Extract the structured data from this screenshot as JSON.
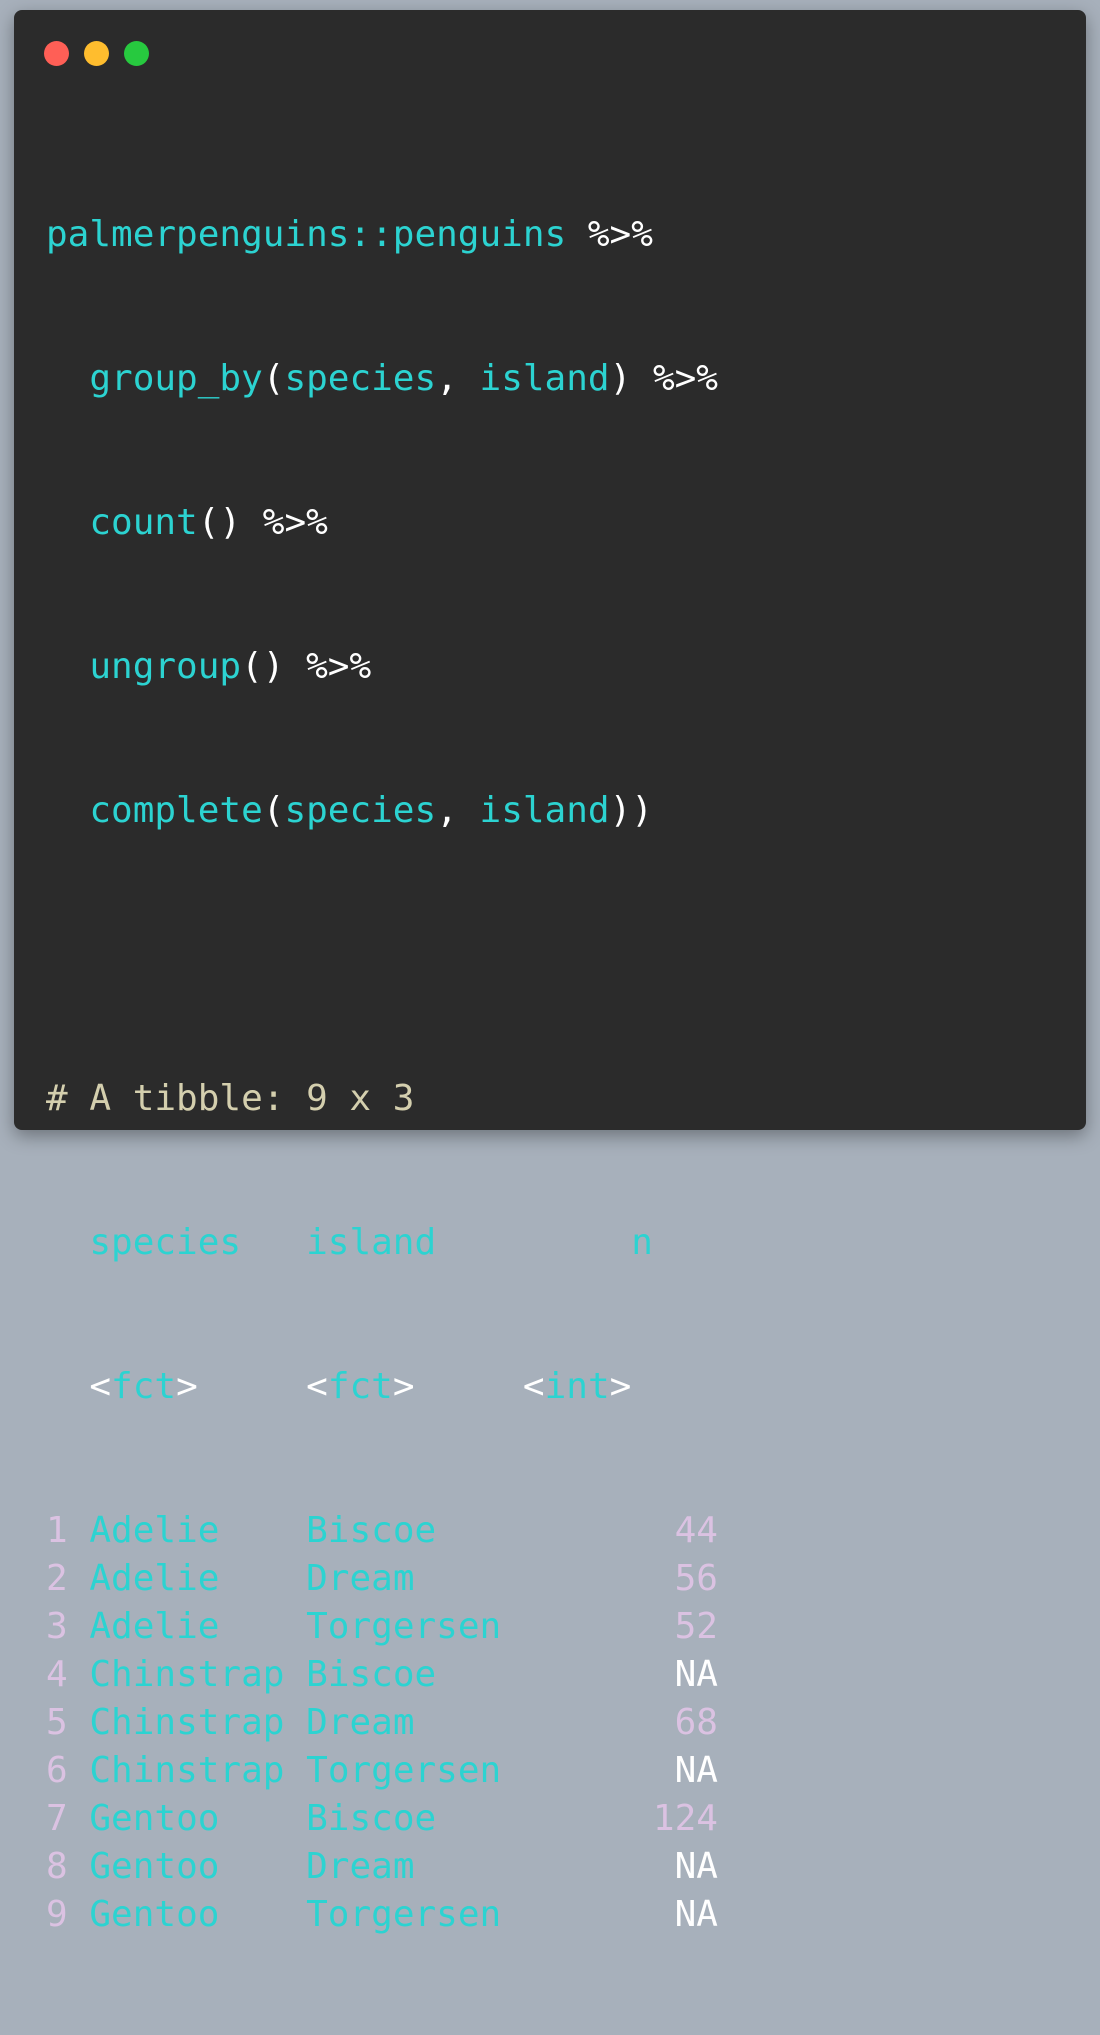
{
  "window": {
    "controls": [
      "close",
      "minimize",
      "maximize"
    ],
    "colors": {
      "close": "#ff5f56",
      "minimize": "#ffbd2e",
      "maximize": "#27c93f"
    }
  },
  "code": {
    "line1": {
      "fn": "palmerpenguins::penguins",
      "pipe": "%>%"
    },
    "line2": {
      "fn": "group_by",
      "open": "(",
      "arg1": "species",
      "comma": ",",
      "arg2": "island",
      "close": ")",
      "pipe": "%>%"
    },
    "line3": {
      "fn": "count",
      "parens": "()",
      "pipe": "%>%"
    },
    "line4": {
      "fn": "ungroup",
      "parens": "()",
      "pipe": "%>%"
    },
    "line5": {
      "fn": "complete",
      "open": "(",
      "arg1": "species",
      "comma": ",",
      "arg2": "island",
      "close": "))"
    }
  },
  "output": {
    "header": "# A tibble: 9 x 3",
    "columns": [
      "species",
      "island",
      "n"
    ],
    "types": [
      {
        "lt": "<",
        "name": "fct",
        "gt": ">"
      },
      {
        "lt": "<",
        "name": "fct",
        "gt": ">"
      },
      {
        "lt": "<",
        "name": "int",
        "gt": ">"
      }
    ],
    "rows": [
      {
        "idx": "1",
        "species": "Adelie",
        "island": "Biscoe",
        "n": "44"
      },
      {
        "idx": "2",
        "species": "Adelie",
        "island": "Dream",
        "n": "56"
      },
      {
        "idx": "3",
        "species": "Adelie",
        "island": "Torgersen",
        "n": "52"
      },
      {
        "idx": "4",
        "species": "Chinstrap",
        "island": "Biscoe",
        "n": "NA"
      },
      {
        "idx": "5",
        "species": "Chinstrap",
        "island": "Dream",
        "n": "68"
      },
      {
        "idx": "6",
        "species": "Chinstrap",
        "island": "Torgersen",
        "n": "NA"
      },
      {
        "idx": "7",
        "species": "Gentoo",
        "island": "Biscoe",
        "n": "124"
      },
      {
        "idx": "8",
        "species": "Gentoo",
        "island": "Dream",
        "n": "NA"
      },
      {
        "idx": "9",
        "species": "Gentoo",
        "island": "Torgersen",
        "n": "NA"
      }
    ]
  },
  "colors": {
    "background": "#2b2b2b",
    "function": "#2cd3d1",
    "comment": "#d4cfae",
    "number": "#dbc2e2",
    "text": "#ffffff"
  }
}
